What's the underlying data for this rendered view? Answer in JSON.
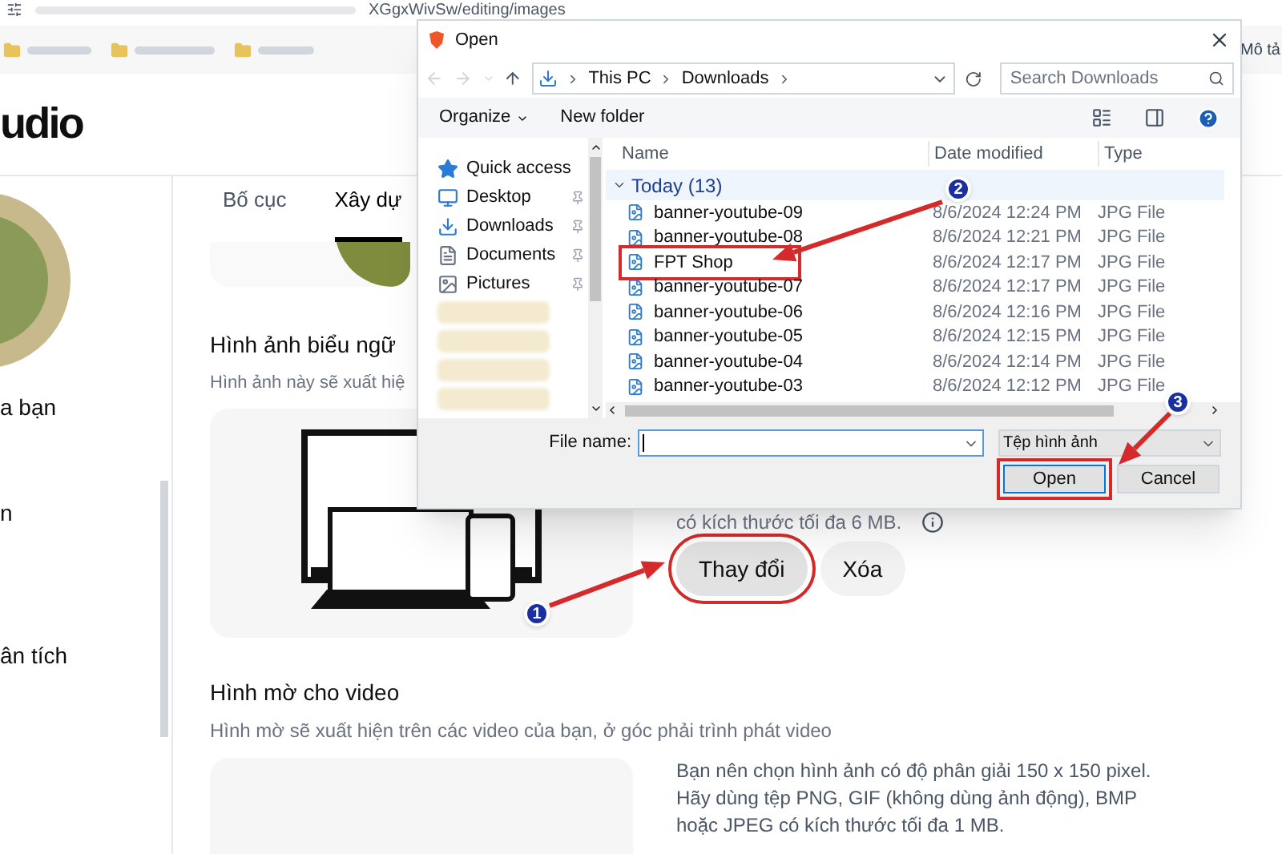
{
  "browser": {
    "url": "XGgxWivSw/editing/images",
    "bookmark": "Mô tả"
  },
  "studio": {
    "logo_text": "udio",
    "sidebar_items": [
      "a bạn",
      "n",
      "ân tích"
    ],
    "tabs": [
      {
        "label": "Bố cục",
        "selected": false
      },
      {
        "label": "Xây dự",
        "selected": true
      }
    ],
    "banner": {
      "title": "Hình ảnh biểu ngữ",
      "description": "Hình ảnh này sẽ xuất hiệ",
      "note": "có kích thước tối đa 6 MB.",
      "buttons": [
        {
          "label": "Thay đổi",
          "highlighted": true
        },
        {
          "label": "Xóa",
          "highlighted": false
        }
      ]
    },
    "watermark": {
      "title": "Hình mờ cho video",
      "description": "Hình mờ sẽ xuất hiện trên các video của bạn, ở góc phải trình phát video",
      "note_lines": [
        "Bạn nên chọn hình ảnh có độ phân giải 150 x 150 pixel.",
        "Hãy dùng tệp PNG, GIF (không dùng ảnh động), BMP",
        "hoặc JPEG có kích thước tối đa 1 MB."
      ]
    }
  },
  "dialog": {
    "title": "Open",
    "breadcrumb": [
      "This PC",
      "Downloads"
    ],
    "search_placeholder": "Search Downloads",
    "toolbar": [
      "Organize",
      "New folder"
    ],
    "nav_items": [
      {
        "kind": "star",
        "label": "Quick access",
        "pinned": false
      },
      {
        "kind": "desktop",
        "label": "Desktop",
        "pinned": true
      },
      {
        "kind": "download",
        "label": "Downloads",
        "pinned": true
      },
      {
        "kind": "documents",
        "label": "Documents",
        "pinned": true
      },
      {
        "kind": "pictures",
        "label": "Pictures",
        "pinned": true
      }
    ],
    "columns": [
      "Name",
      "Date modified",
      "Type"
    ],
    "group": "Today (13)",
    "files": [
      {
        "name": "banner-youtube-09",
        "date": "8/6/2024 12:24 PM",
        "type": "JPG File",
        "highlighted": false
      },
      {
        "name": "banner-youtube-08",
        "date": "8/6/2024 12:21 PM",
        "type": "JPG File",
        "highlighted": false
      },
      {
        "name": "FPT Shop",
        "date": "8/6/2024 12:17 PM",
        "type": "JPG File",
        "highlighted": true
      },
      {
        "name": "banner-youtube-07",
        "date": "8/6/2024 12:17 PM",
        "type": "JPG File",
        "highlighted": false
      },
      {
        "name": "banner-youtube-06",
        "date": "8/6/2024 12:16 PM",
        "type": "JPG File",
        "highlighted": false
      },
      {
        "name": "banner-youtube-05",
        "date": "8/6/2024 12:15 PM",
        "type": "JPG File",
        "highlighted": false
      },
      {
        "name": "banner-youtube-04",
        "date": "8/6/2024 12:14 PM",
        "type": "JPG File",
        "highlighted": false
      },
      {
        "name": "banner-youtube-03",
        "date": "8/6/2024 12:12 PM",
        "type": "JPG File",
        "highlighted": false
      }
    ],
    "file_name_label": "File name:",
    "file_type": "Tệp hình ảnh",
    "buttons": [
      {
        "label": "Open",
        "highlighted": true
      },
      {
        "label": "Cancel",
        "highlighted": false
      }
    ]
  },
  "annotations": [
    {
      "number": "1"
    },
    {
      "number": "2"
    },
    {
      "number": "3"
    }
  ]
}
